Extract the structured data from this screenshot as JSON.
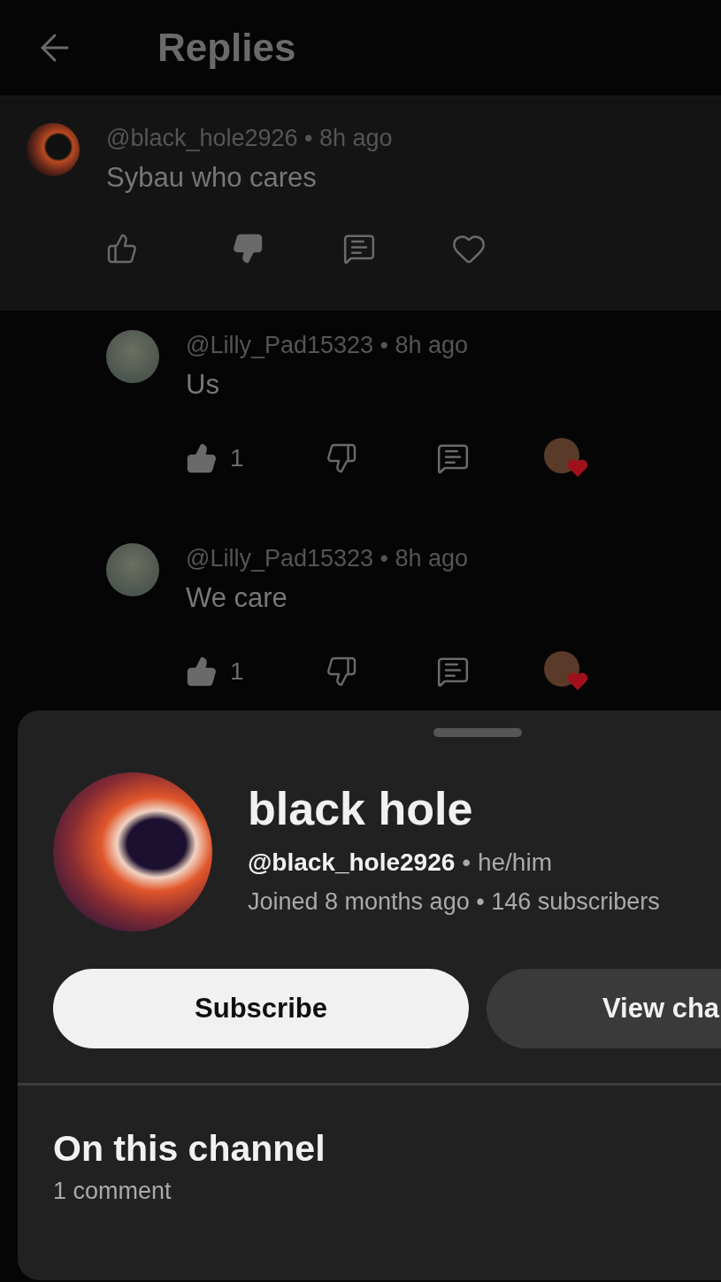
{
  "header": {
    "title": "Replies"
  },
  "comment": {
    "meta": "@black_hole2926 • 8h ago",
    "text": "Sybau who cares",
    "highlighted": true,
    "liked": false,
    "disliked": true,
    "hearted": false
  },
  "replies": [
    {
      "meta": "@Lilly_Pad15323 • 8h ago",
      "text": "Us",
      "highlighted": false,
      "liked": true,
      "like_count": "1",
      "disliked": false,
      "hearted": true
    },
    {
      "meta": "@Lilly_Pad15323 • 8h ago",
      "text": "We care",
      "highlighted": false,
      "liked": true,
      "like_count": "1",
      "disliked": false,
      "hearted": true
    }
  ],
  "channel_sheet": {
    "name": "black hole",
    "handle": "@black_hole2926",
    "pronouns": "• he/him",
    "details": "Joined 8 months ago • 146 subscribers",
    "buttons": [
      {
        "label": "Subscribe",
        "kind": "primary"
      },
      {
        "label": "View cha",
        "kind": "secondary"
      }
    ],
    "section_title": "On this channel",
    "section_count": "1 comment"
  }
}
